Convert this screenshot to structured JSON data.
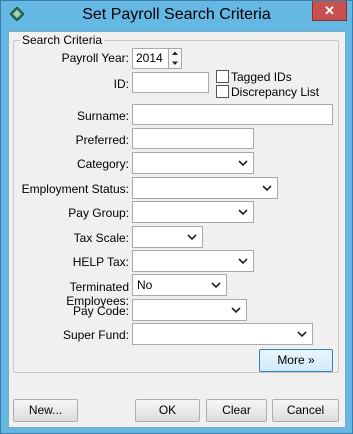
{
  "window": {
    "title": "Set Payroll Search Criteria",
    "close_glyph": "✕"
  },
  "group": {
    "legend": "Search Criteria"
  },
  "fields": {
    "payroll_year": {
      "label": "Payroll Year:",
      "value": "2014"
    },
    "id": {
      "label": "ID:",
      "value": ""
    },
    "tagged_ids": {
      "label": "Tagged IDs",
      "checked": false
    },
    "discrepancy_list": {
      "label": "Discrepancy List",
      "checked": false
    },
    "surname": {
      "label": "Surname:",
      "value": ""
    },
    "preferred": {
      "label": "Preferred:",
      "value": ""
    },
    "category": {
      "label": "Category:",
      "value": ""
    },
    "employment_status": {
      "label": "Employment Status:",
      "value": ""
    },
    "pay_group": {
      "label": "Pay Group:",
      "value": ""
    },
    "tax_scale": {
      "label": "Tax Scale:",
      "value": ""
    },
    "help_tax": {
      "label": "HELP Tax:",
      "value": ""
    },
    "terminated_employees": {
      "label": "Terminated Employees:",
      "value": "No"
    },
    "pay_code": {
      "label": "Pay Code:",
      "value": ""
    },
    "super_fund": {
      "label": "Super Fund:",
      "value": ""
    }
  },
  "buttons": {
    "more": "More »",
    "new": "New...",
    "ok": "OK",
    "clear": "Clear",
    "cancel": "Cancel"
  },
  "icons": {
    "app": "app-diamond-icon",
    "dropdown": "chevron-down-icon",
    "spin_up": "spin-up-icon",
    "spin_down": "spin-down-icon"
  },
  "colors": {
    "titlebar": "#65b8e4",
    "close": "#c75050",
    "accent_button_border": "#3c7fb1"
  }
}
